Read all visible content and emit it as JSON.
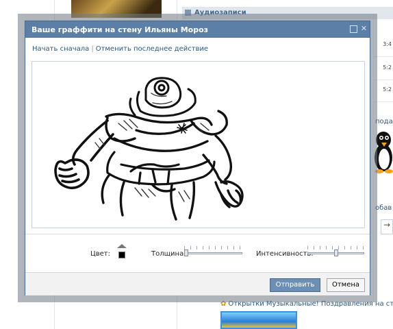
{
  "background": {
    "audio_header": "Аудиозаписи",
    "times": [
      "3:4",
      "5:2",
      "5:2"
    ],
    "gift_text": "подар",
    "add_text": "обав",
    "arrow": "→",
    "postcards_link": "Открытки Музыкальные! Поздравления на стену"
  },
  "dialog": {
    "title": "Ваше граффити на стену Ильяны Мороз",
    "links": {
      "restart": "Начать сначала",
      "separator": "|",
      "undo": "Отменить последнее действие"
    },
    "controls": {
      "color_label": "Цвет:",
      "color_value": "#000000",
      "thickness_label": "Толщина:",
      "thickness_value": 0.0,
      "intensity_label": "Интенсивность:",
      "intensity_value": 0.5
    },
    "buttons": {
      "send": "Отправить",
      "cancel": "Отмена"
    }
  },
  "colors": {
    "title_bar": "#5b7fa6",
    "link": "#2b587a",
    "send_button": "#6d8fb3"
  }
}
